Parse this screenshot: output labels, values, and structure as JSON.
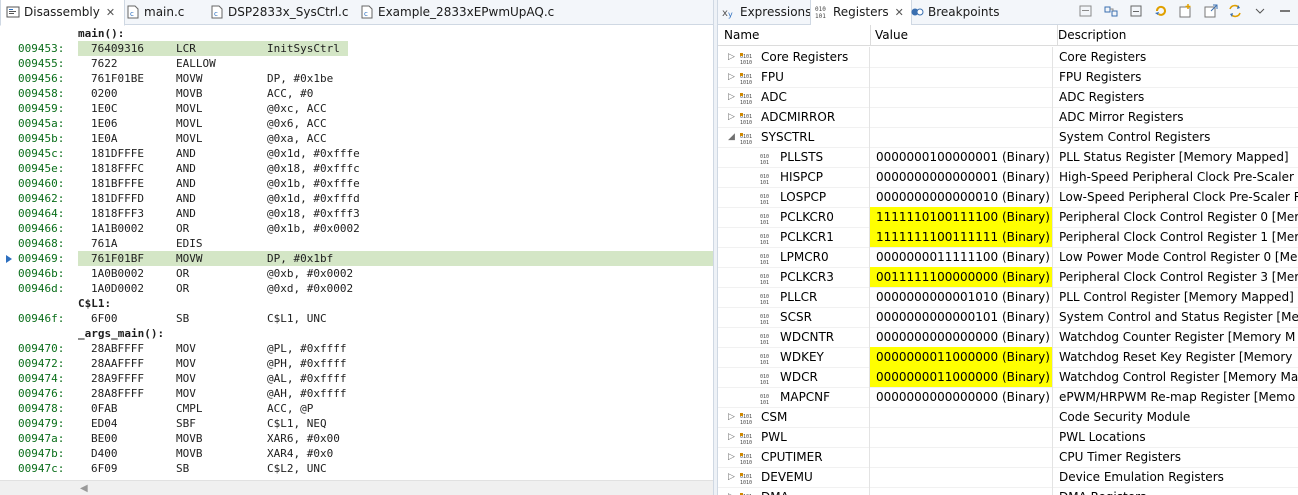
{
  "left_tabs": [
    {
      "label": "Disassembly",
      "active": true
    },
    {
      "label": "main.c"
    },
    {
      "label": "DSP2833x_SysCtrl.c"
    },
    {
      "label": "Example_2833xEPwmUpAQ.c"
    }
  ],
  "disassembly": [
    {
      "type": "label",
      "text": "main():"
    },
    {
      "addr": "009453:",
      "op": "76409316",
      "mn": "LCR",
      "arg": "InitSysCtrl",
      "hl": "short"
    },
    {
      "addr": "009455:",
      "op": "7622",
      "mn": "EALLOW",
      "arg": ""
    },
    {
      "addr": "009456:",
      "op": "761F01BE",
      "mn": "MOVW",
      "arg": "DP, #0x1be"
    },
    {
      "addr": "009458:",
      "op": "0200",
      "mn": "MOVB",
      "arg": "ACC, #0"
    },
    {
      "addr": "009459:",
      "op": "1E0C",
      "mn": "MOVL",
      "arg": "@0xc, ACC"
    },
    {
      "addr": "00945a:",
      "op": "1E06",
      "mn": "MOVL",
      "arg": "@0x6, ACC"
    },
    {
      "addr": "00945b:",
      "op": "1E0A",
      "mn": "MOVL",
      "arg": "@0xa, ACC"
    },
    {
      "addr": "00945c:",
      "op": "181DFFFE",
      "mn": "AND",
      "arg": "@0x1d, #0xfffe"
    },
    {
      "addr": "00945e:",
      "op": "1818FFFC",
      "mn": "AND",
      "arg": "@0x18, #0xfffc"
    },
    {
      "addr": "009460:",
      "op": "181BFFFE",
      "mn": "AND",
      "arg": "@0x1b, #0xfffe"
    },
    {
      "addr": "009462:",
      "op": "181DFFFD",
      "mn": "AND",
      "arg": "@0x1d, #0xfffd"
    },
    {
      "addr": "009464:",
      "op": "1818FFF3",
      "mn": "AND",
      "arg": "@0x18, #0xfff3"
    },
    {
      "addr": "009466:",
      "op": "1A1B0002",
      "mn": "OR",
      "arg": "@0x1b, #0x0002"
    },
    {
      "addr": "009468:",
      "op": "761A",
      "mn": "EDIS",
      "arg": ""
    },
    {
      "addr": "009469:",
      "op": "761F01BF",
      "mn": "MOVW",
      "arg": "DP, #0x1bf",
      "hl": "current"
    },
    {
      "addr": "00946b:",
      "op": "1A0B0002",
      "mn": "OR",
      "arg": "@0xb, #0x0002"
    },
    {
      "addr": "00946d:",
      "op": "1A0D0002",
      "mn": "OR",
      "arg": "@0xd, #0x0002"
    },
    {
      "type": "label",
      "text": "C$L1:"
    },
    {
      "addr": "00946f:",
      "op": "6F00",
      "mn": "SB",
      "arg": "C$L1, UNC"
    },
    {
      "type": "label",
      "text": "_args_main():"
    },
    {
      "addr": "009470:",
      "op": "28ABFFFF",
      "mn": "MOV",
      "arg": "@PL, #0xffff"
    },
    {
      "addr": "009472:",
      "op": "28AAFFFF",
      "mn": "MOV",
      "arg": "@PH, #0xffff"
    },
    {
      "addr": "009474:",
      "op": "28A9FFFF",
      "mn": "MOV",
      "arg": "@AL, #0xffff"
    },
    {
      "addr": "009476:",
      "op": "28A8FFFF",
      "mn": "MOV",
      "arg": "@AH, #0xffff"
    },
    {
      "addr": "009478:",
      "op": "0FAB",
      "mn": "CMPL",
      "arg": "ACC, @P"
    },
    {
      "addr": "009479:",
      "op": "ED04",
      "mn": "SBF",
      "arg": "C$L1, NEQ"
    },
    {
      "addr": "00947a:",
      "op": "BE00",
      "mn": "MOVB",
      "arg": "XAR6, #0x00"
    },
    {
      "addr": "00947b:",
      "op": "D400",
      "mn": "MOVB",
      "arg": "XAR4, #0x0"
    },
    {
      "addr": "00947c:",
      "op": "6F09",
      "mn": "SB",
      "arg": "C$L2, UNC"
    }
  ],
  "right_tabs": [
    {
      "label": "Expressions"
    },
    {
      "label": "Registers",
      "active": true
    },
    {
      "label": "Breakpoints"
    }
  ],
  "columns": {
    "name": "Name",
    "value": "Value",
    "description": "Description"
  },
  "registers": [
    {
      "level": 0,
      "twisty": "closed",
      "name": "Core Registers",
      "value": "",
      "desc": "Core Registers"
    },
    {
      "level": 0,
      "twisty": "closed",
      "name": "FPU",
      "value": "",
      "desc": "FPU Registers"
    },
    {
      "level": 0,
      "twisty": "closed",
      "name": "ADC",
      "value": "",
      "desc": "ADC Registers"
    },
    {
      "level": 0,
      "twisty": "closed",
      "name": "ADCMIRROR",
      "value": "",
      "desc": "ADC Mirror Registers"
    },
    {
      "level": 0,
      "twisty": "open",
      "name": "SYSCTRL",
      "value": "",
      "desc": "System Control Registers"
    },
    {
      "level": 1,
      "name": "PLLSTS",
      "value": "0000000100000001 (Binary)",
      "desc": "PLL Status Register [Memory Mapped]"
    },
    {
      "level": 1,
      "name": "HISPCP",
      "value": "0000000000000001 (Binary)",
      "desc": "High-Speed Peripheral Clock Pre-Scaler"
    },
    {
      "level": 1,
      "name": "LOSPCP",
      "value": "0000000000000010 (Binary)",
      "desc": "Low-Speed Peripheral Clock Pre-Scaler R"
    },
    {
      "level": 1,
      "name": "PCLKCR0",
      "value": "1111110100111100 (Binary)",
      "desc": "Peripheral Clock Control Register 0 [Mer",
      "changed": true
    },
    {
      "level": 1,
      "name": "PCLKCR1",
      "value": "1111111100111111 (Binary)",
      "desc": "Peripheral Clock Control Register 1 [Mer",
      "changed": true
    },
    {
      "level": 1,
      "name": "LPMCR0",
      "value": "0000000011111100 (Binary)",
      "desc": "Low Power Mode Control Register 0 [Me"
    },
    {
      "level": 1,
      "name": "PCLKCR3",
      "value": "0011111100000000 (Binary)",
      "desc": "Peripheral Clock Control Register 3 [Mer",
      "changed": true
    },
    {
      "level": 1,
      "name": "PLLCR",
      "value": "0000000000001010 (Binary)",
      "desc": "PLL Control Register [Memory Mapped]"
    },
    {
      "level": 1,
      "name": "SCSR",
      "value": "0000000000000101 (Binary)",
      "desc": "System Control and Status Register [Mer"
    },
    {
      "level": 1,
      "name": "WDCNTR",
      "value": "0000000000000000 (Binary)",
      "desc": "Watchdog Counter Register [Memory M"
    },
    {
      "level": 1,
      "name": "WDKEY",
      "value": "0000000011000000 (Binary)",
      "desc": "Watchdog Reset Key Register [Memory",
      "changed": true
    },
    {
      "level": 1,
      "name": "WDCR",
      "value": "0000000011000000 (Binary)",
      "desc": "Watchdog Control Register [Memory Ma",
      "changed": true
    },
    {
      "level": 1,
      "name": "MAPCNF",
      "value": "0000000000000000 (Binary)",
      "desc": "ePWM/HRPWM Re-map Register [Memo"
    },
    {
      "level": 0,
      "twisty": "closed",
      "name": "CSM",
      "value": "",
      "desc": "Code Security Module"
    },
    {
      "level": 0,
      "twisty": "closed",
      "name": "PWL",
      "value": "",
      "desc": "PWL Locations"
    },
    {
      "level": 0,
      "twisty": "closed",
      "name": "CPUTIMER",
      "value": "",
      "desc": "CPU Timer Registers"
    },
    {
      "level": 0,
      "twisty": "closed",
      "name": "DEVEMU",
      "value": "",
      "desc": "Device Emulation Registers"
    },
    {
      "level": 0,
      "twisty": "closed",
      "name": "DMA",
      "value": "",
      "desc": "DMA Registers"
    }
  ],
  "colors": {
    "changed_value_bg": "#ffff00",
    "current_line_bg": "#d4e6c6",
    "address_color": "#0a6e1a"
  }
}
